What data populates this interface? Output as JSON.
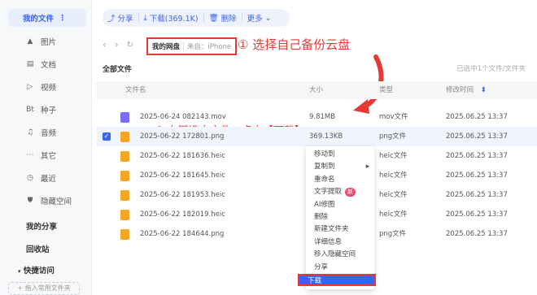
{
  "sidebar": {
    "myfiles": "我的文件",
    "items": [
      {
        "label": "图片",
        "icon": "image-icon"
      },
      {
        "label": "文档",
        "icon": "document-icon"
      },
      {
        "label": "视频",
        "icon": "video-icon"
      },
      {
        "label": "种子",
        "icon": "torrent-icon"
      },
      {
        "label": "音频",
        "icon": "audio-icon"
      },
      {
        "label": "其它",
        "icon": "more-icon"
      },
      {
        "label": "最近",
        "icon": "clock-icon"
      },
      {
        "label": "隐藏空间",
        "icon": "lock-icon"
      }
    ],
    "share": "我的分享",
    "recycle": "回收站",
    "quick": "快捷访问",
    "add_quick": "+ 拖入常用文件夹"
  },
  "toolbar": {
    "share": "分享",
    "download": "下载(369.1K)",
    "delete": "删除",
    "more": "更多"
  },
  "breadcrumb": {
    "root": "我的网盘",
    "source": "来自：iPhone"
  },
  "annotations": {
    "step1": "① 选择自己备份云盘",
    "step2": "② 右键选中文件，点击【下载】"
  },
  "list": {
    "title": "全部文件",
    "selection": "已选中1个文件/文件夹",
    "headers": {
      "name": "文件名",
      "size": "大小",
      "type": "类型",
      "modified": "修改时间"
    }
  },
  "files": [
    {
      "name": "2025-06-24 082143.mov",
      "size": "9.81MB",
      "type": "mov文件",
      "date": "2025.06.25 13:37",
      "icon": "video-file-icon",
      "color": "#7b6ef6",
      "selected": false
    },
    {
      "name": "2025-06-22 172801.png",
      "size": "369.13KB",
      "type": "png文件",
      "date": "2025.06.25 13:37",
      "icon": "image-file-icon",
      "color": "#f5a623",
      "selected": true
    },
    {
      "name": "2025-06-22 181636.heic",
      "size": "",
      "type": "heic文件",
      "date": "2025.06.25 13:37",
      "icon": "image-file-icon",
      "color": "#f5a623",
      "selected": false
    },
    {
      "name": "2025-06-22 181645.heic",
      "size": "",
      "type": "heic文件",
      "date": "2025.06.25 13:37",
      "icon": "image-file-icon",
      "color": "#f5a623",
      "selected": false
    },
    {
      "name": "2025-06-22 181953.heic",
      "size": "",
      "type": "heic文件",
      "date": "2025.06.25 13:37",
      "icon": "image-file-icon",
      "color": "#f5a623",
      "selected": false
    },
    {
      "name": "2025-06-22 182019.heic",
      "size": "",
      "type": "heic文件",
      "date": "2025.06.25 13:37",
      "icon": "image-file-icon",
      "color": "#f5a623",
      "selected": false
    },
    {
      "name": "2025-06-22 184644.png",
      "size": "",
      "type": "png文件",
      "date": "2025.06.25 13:37",
      "icon": "image-file-icon",
      "color": "#f5a623",
      "selected": false
    }
  ],
  "context_menu": [
    "移动到",
    "复制到",
    "重命名",
    "文字提取",
    "AI修图",
    "删除",
    "新建文件夹",
    "详细信息",
    "移入隐藏空间",
    "分享",
    "下载"
  ],
  "badge_new": "新",
  "colors": {
    "accent": "#3a63f0",
    "annotation": "#e53935"
  }
}
